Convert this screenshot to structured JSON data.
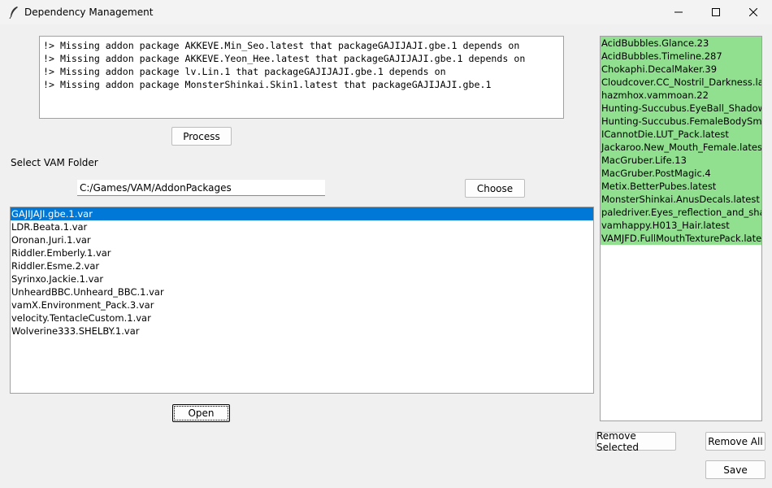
{
  "window": {
    "title": "Dependency Management"
  },
  "log": {
    "lines": [
      "!> Missing addon package AKKEVE.Min_Seo.latest that packageGAJIJAJI.gbe.1 depends on",
      "!> Missing addon package AKKEVE.Yeon_Hee.latest that packageGAJIJAJI.gbe.1 depends on",
      "!> Missing addon package lv.Lin.1 that packageGAJIJAJI.gbe.1 depends on",
      "!> Missing addon package MonsterShinkai.Skin1.latest that packageGAJIJAJI.gbe.1"
    ]
  },
  "buttons": {
    "process": "Process",
    "choose": "Choose",
    "open": "Open",
    "remove_selected": "Remove Selected",
    "remove_all": "Remove All",
    "save": "Save"
  },
  "folder": {
    "label": "Select VAM Folder",
    "value": "C:/Games/VAM/AddonPackages"
  },
  "packages": [
    "GAJIJAJI.gbe.1.var",
    "LDR.Beata.1.var",
    "Oronan.Juri.1.var",
    "Riddler.Emberly.1.var",
    "Riddler.Esme.2.var",
    "Syrinxo.Jackie.1.var",
    "UnheardBBC.Unheard_BBC.1.var",
    "vamX.Environment_Pack.3.var",
    "velocity.TentacleCustom.1.var",
    "Wolverine333.SHELBY.1.var"
  ],
  "selected_package_index": 0,
  "dependencies": [
    "AcidBubbles.Glance.23",
    "AcidBubbles.Timeline.287",
    "Chokaphi.DecalMaker.39",
    "Cloudcover.CC_Nostril_Darkness.latest",
    "hazmhox.vammoan.22",
    "Hunting-Succubus.EyeBall_Shadow.latest",
    "Hunting-Succubus.FemaleBodySmooth",
    "ICannotDie.LUT_Pack.latest",
    "Jackaroo.New_Mouth_Female.latest",
    "MacGruber.Life.13",
    "MacGruber.PostMagic.4",
    "Metix.BetterPubes.latest",
    "MonsterShinkai.AnusDecals.latest",
    "paledriver.Eyes_reflection_and_shadow",
    "vamhappy.H013_Hair.latest",
    "VAMJFD.FullMouthTexturePack.latest"
  ],
  "colors": {
    "selection": "#0078d7",
    "dependency_bg": "#90e090"
  }
}
